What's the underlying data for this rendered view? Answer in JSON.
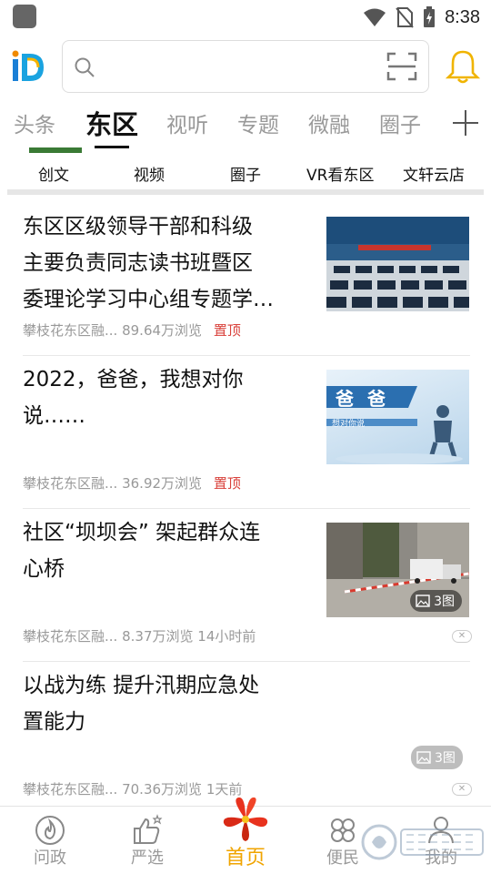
{
  "status_bar": {
    "time": "8:38"
  },
  "search": {
    "placeholder": ""
  },
  "channels": [
    "头条",
    "东区",
    "视听",
    "专题",
    "微融",
    "圈子"
  ],
  "active_channel": "东区",
  "subnav": [
    "创文",
    "视频",
    "圈子",
    "VR看东区",
    "文轩云店"
  ],
  "news": [
    {
      "title_lines": [
        "东区区级领导干部和科级",
        "主要负责同志读书班暨区",
        "委理论学习中心组专题学…"
      ],
      "source": "攀枝花东区融...",
      "views": "89.64万浏览",
      "tag": "置顶"
    },
    {
      "title_lines": [
        "2022，爸爸，我想对你",
        "说……"
      ],
      "source": "攀枝花东区融...",
      "views": "36.92万浏览",
      "tag": "置顶",
      "thumb_text": "爸 爸",
      "thumb_sub": "想对你说"
    },
    {
      "title_lines": [
        "社区“坝坝会” 架起群众连",
        "心桥"
      ],
      "source": "攀枝花东区融...",
      "views": "8.37万浏览",
      "time": "14小时前",
      "image_count": "3图"
    },
    {
      "title_lines": [
        "以战为练 提升汛期应急处",
        "置能力"
      ],
      "source": "攀枝花东区融...",
      "views": "70.36万浏览",
      "time": "1天前",
      "image_count": "3图"
    }
  ],
  "bottom_nav": [
    {
      "label": "问政",
      "icon": "fire-icon"
    },
    {
      "label": "严选",
      "icon": "thumbs-up-icon"
    },
    {
      "label": "首页",
      "icon": "flower-icon",
      "active": true
    },
    {
      "label": "便民",
      "icon": "clover-icon"
    },
    {
      "label": "我的",
      "icon": "user-icon"
    }
  ],
  "colors": {
    "accent": "#f0a400",
    "pin": "#d9413b",
    "bell": "#f0b400"
  }
}
